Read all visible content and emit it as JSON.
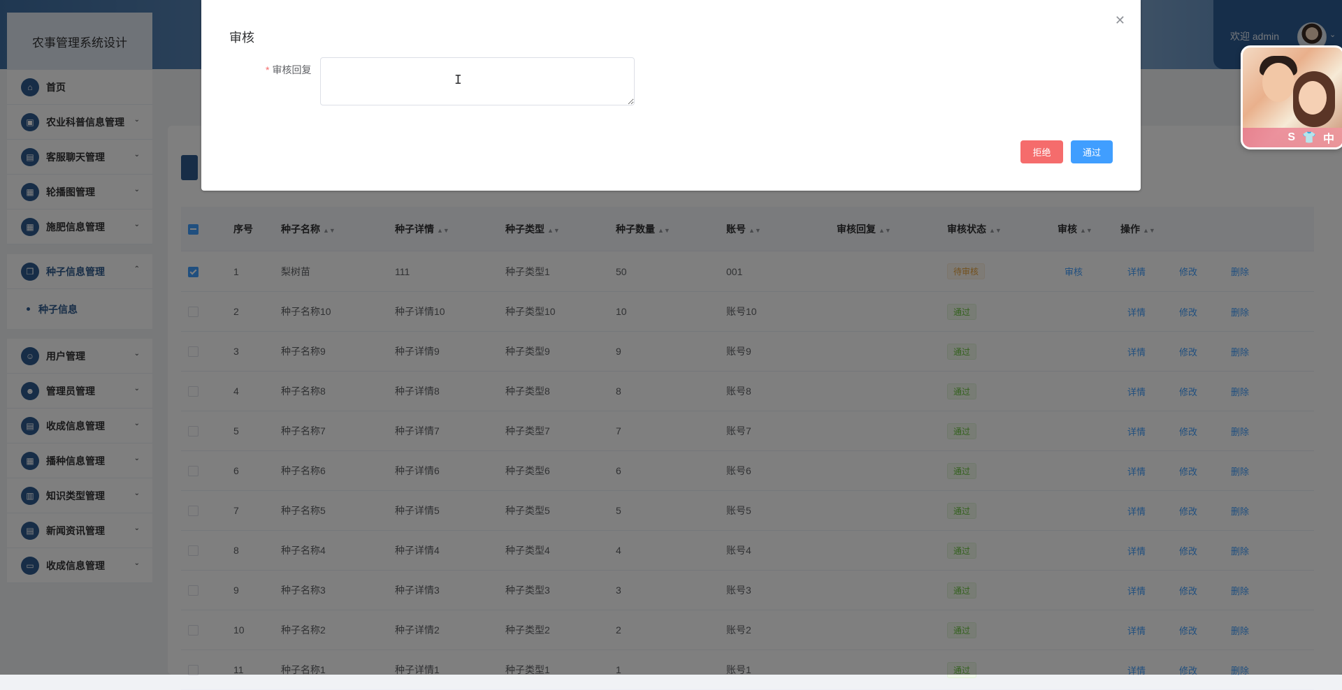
{
  "header": {
    "welcome": "欢迎 admin"
  },
  "sidebar": {
    "brand": "农事管理系统设计",
    "items_top": [
      {
        "label": "首页"
      },
      {
        "label": "农业科普信息管理"
      },
      {
        "label": "客服聊天管理"
      },
      {
        "label": "轮播图管理"
      },
      {
        "label": "施肥信息管理"
      }
    ],
    "active_group": {
      "label": "种子信息管理",
      "sub_items": [
        {
          "label": "种子信息"
        }
      ]
    },
    "items_bottom": [
      {
        "label": "用户管理"
      },
      {
        "label": "管理员管理"
      },
      {
        "label": "收成信息管理"
      },
      {
        "label": "播种信息管理"
      },
      {
        "label": "知识类型管理"
      },
      {
        "label": "新闻资讯管理"
      },
      {
        "label": "收成信息管理"
      }
    ]
  },
  "table": {
    "columns": [
      "序号",
      "种子名称",
      "种子详情",
      "种子类型",
      "种子数量",
      "账号",
      "审核回复",
      "审核状态",
      "审核",
      "操作"
    ],
    "actions": {
      "review": "审核",
      "detail": "详情",
      "edit": "修改",
      "delete": "删除"
    },
    "rows": [
      {
        "index": "1",
        "name": "梨树苗",
        "detail": "111",
        "type": "种子类型1",
        "qty": "50",
        "account": "001",
        "reply": "",
        "status": "待审核"
      },
      {
        "index": "2",
        "name": "种子名称10",
        "detail": "种子详情10",
        "type": "种子类型10",
        "qty": "10",
        "account": "账号10",
        "reply": "",
        "status": "通过"
      },
      {
        "index": "3",
        "name": "种子名称9",
        "detail": "种子详情9",
        "type": "种子类型9",
        "qty": "9",
        "account": "账号9",
        "reply": "",
        "status": "通过"
      },
      {
        "index": "4",
        "name": "种子名称8",
        "detail": "种子详情8",
        "type": "种子类型8",
        "qty": "8",
        "account": "账号8",
        "reply": "",
        "status": "通过"
      },
      {
        "index": "5",
        "name": "种子名称7",
        "detail": "种子详情7",
        "type": "种子类型7",
        "qty": "7",
        "account": "账号7",
        "reply": "",
        "status": "通过"
      },
      {
        "index": "6",
        "name": "种子名称6",
        "detail": "种子详情6",
        "type": "种子类型6",
        "qty": "6",
        "account": "账号6",
        "reply": "",
        "status": "通过"
      },
      {
        "index": "7",
        "name": "种子名称5",
        "detail": "种子详情5",
        "type": "种子类型5",
        "qty": "5",
        "account": "账号5",
        "reply": "",
        "status": "通过"
      },
      {
        "index": "8",
        "name": "种子名称4",
        "detail": "种子详情4",
        "type": "种子类型4",
        "qty": "4",
        "account": "账号4",
        "reply": "",
        "status": "通过"
      },
      {
        "index": "9",
        "name": "种子名称3",
        "detail": "种子详情3",
        "type": "种子类型3",
        "qty": "3",
        "account": "账号3",
        "reply": "",
        "status": "通过"
      },
      {
        "index": "10",
        "name": "种子名称2",
        "detail": "种子详情2",
        "type": "种子类型2",
        "qty": "2",
        "account": "账号2",
        "reply": "",
        "status": "通过"
      },
      {
        "index": "11",
        "name": "种子名称1",
        "detail": "种子详情1",
        "type": "种子类型1",
        "qty": "1",
        "account": "账号1",
        "reply": "",
        "status": "通过"
      }
    ]
  },
  "dialog": {
    "title": "审核",
    "field_label": "审核回复",
    "field_value": "",
    "reject_label": "拒绝",
    "pass_label": "通过"
  },
  "float_widget": {
    "icons": [
      "S",
      "👕",
      "中"
    ]
  }
}
